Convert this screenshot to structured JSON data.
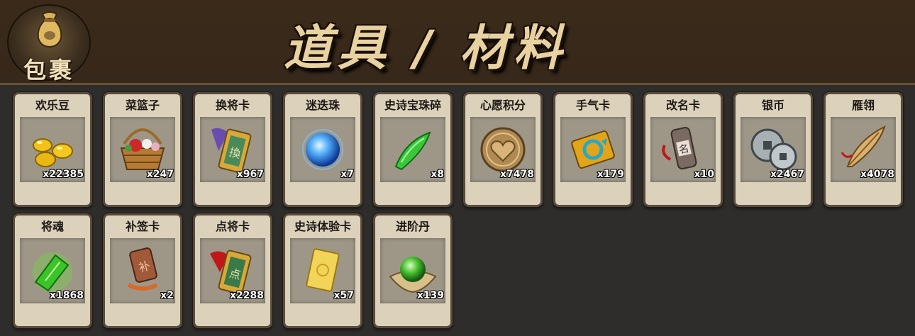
{
  "header": {
    "logo_text": "包裹",
    "title": "道具 / 材料"
  },
  "items": [
    {
      "name": "欢乐豆",
      "qty": "x22385",
      "icon": "gold-beans-icon"
    },
    {
      "name": "菜篮子",
      "qty": "x247",
      "icon": "flower-basket-icon"
    },
    {
      "name": "换将卡",
      "qty": "x967",
      "icon": "swap-general-card-icon"
    },
    {
      "name": "迷迭珠",
      "qty": "x7",
      "icon": "blue-orb-icon"
    },
    {
      "name": "史诗宝珠碎",
      "qty": "x8",
      "icon": "green-shard-icon"
    },
    {
      "name": "心愿积分",
      "qty": "x7478",
      "icon": "heart-coin-icon"
    },
    {
      "name": "手气卡",
      "qty": "x179",
      "icon": "luck-card-icon"
    },
    {
      "name": "改名卡",
      "qty": "x10",
      "icon": "rename-card-icon"
    },
    {
      "name": "银币",
      "qty": "x2467",
      "icon": "silver-coins-icon"
    },
    {
      "name": "雁翎",
      "qty": "x4078",
      "icon": "feather-quill-icon"
    },
    {
      "name": "将魂",
      "qty": "x1868",
      "icon": "green-crystal-icon"
    },
    {
      "name": "补签卡",
      "qty": "x2",
      "icon": "makeup-sign-card-icon"
    },
    {
      "name": "点将卡",
      "qty": "x2288",
      "icon": "pick-general-card-icon"
    },
    {
      "name": "史诗体验卡",
      "qty": "x57",
      "icon": "gold-trial-card-icon"
    },
    {
      "name": "进阶丹",
      "qty": "x139",
      "icon": "green-pill-icon"
    }
  ]
}
